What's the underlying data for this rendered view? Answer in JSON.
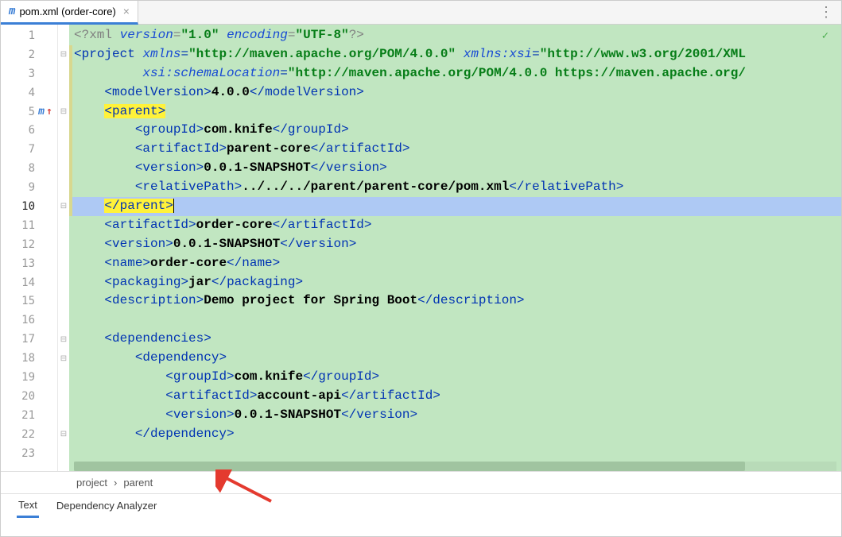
{
  "tab": {
    "icon": "m",
    "label": "pom.xml (order-core)",
    "close": "×"
  },
  "menu_dots": "⋮",
  "gutter": {
    "lines": [
      "1",
      "2",
      "3",
      "4",
      "5",
      "6",
      "7",
      "8",
      "9",
      "10",
      "11",
      "12",
      "13",
      "14",
      "15",
      "16",
      "17",
      "18",
      "19",
      "20",
      "21",
      "22",
      "23"
    ],
    "current": 10,
    "marker_line": 5,
    "marker_m": "m",
    "marker_arrow": "↑"
  },
  "fold": {
    "2": "⊟",
    "5": "⊟",
    "10": "⊟",
    "17": "⊟",
    "18": "⊟",
    "22": "⊟"
  },
  "code": {
    "l1": {
      "pi_open": "<?",
      "pi_name": "xml ",
      "a1": "version",
      "eq": "=",
      "v1": "\"1.0\"",
      "sp": " ",
      "a2": "encoding",
      "v2": "\"UTF-8\"",
      "pi_close": "?>"
    },
    "l2": {
      "open": "<",
      "tag": "project",
      "sp": " ",
      "a1": "xmlns",
      "eq": "=",
      "v1": "\"http://maven.apache.org/POM/4.0.0\"",
      "sp2": " ",
      "a2": "xmlns:xsi",
      "v2": "\"http://www.w3.org/2001/XML"
    },
    "l3": {
      "a1": "xsi:schemaLocation",
      "eq": "=",
      "v1": "\"http://maven.apache.org/POM/4.0.0 https://maven.apache.org/"
    },
    "l4": {
      "o": "<",
      "t": "modelVersion",
      "c": ">",
      "txt": "4.0.0",
      "co": "</",
      "cc": ">"
    },
    "l5": {
      "o": "<",
      "t": "parent",
      "c": ">"
    },
    "l6": {
      "o": "<",
      "t": "groupId",
      "c": ">",
      "txt": "com.knife",
      "co": "</",
      "cc": ">"
    },
    "l7": {
      "o": "<",
      "t": "artifactId",
      "c": ">",
      "txt": "parent-core",
      "co": "</",
      "cc": ">"
    },
    "l8": {
      "o": "<",
      "t": "version",
      "c": ">",
      "txt": "0.0.1-SNAPSHOT",
      "co": "</",
      "cc": ">"
    },
    "l9": {
      "o": "<",
      "t": "relativePath",
      "c": ">",
      "txt": "../../../parent/parent-core/pom.xml",
      "co": "</",
      "cc": ">"
    },
    "l10": {
      "o": "</",
      "t": "parent",
      "c": ">"
    },
    "l11": {
      "o": "<",
      "t": "artifactId",
      "c": ">",
      "txt": "order-core",
      "co": "</",
      "cc": ">"
    },
    "l12": {
      "o": "<",
      "t": "version",
      "c": ">",
      "txt": "0.0.1-SNAPSHOT",
      "co": "</",
      "cc": ">"
    },
    "l13": {
      "o": "<",
      "t": "name",
      "c": ">",
      "txt": "order-core",
      "co": "</",
      "cc": ">"
    },
    "l14": {
      "o": "<",
      "t": "packaging",
      "c": ">",
      "txt": "jar",
      "co": "</",
      "cc": ">"
    },
    "l15": {
      "o": "<",
      "t": "description",
      "c": ">",
      "txt": "Demo project for Spring Boot",
      "co": "</",
      "cc": ">"
    },
    "l17": {
      "o": "<",
      "t": "dependencies",
      "c": ">"
    },
    "l18": {
      "o": "<",
      "t": "dependency",
      "c": ">"
    },
    "l19": {
      "o": "<",
      "t": "groupId",
      "c": ">",
      "txt": "com.knife",
      "co": "</",
      "cc": ">"
    },
    "l20": {
      "o": "<",
      "t": "artifactId",
      "c": ">",
      "txt": "account-api",
      "co": "</",
      "cc": ">"
    },
    "l21": {
      "o": "<",
      "t": "version",
      "c": ">",
      "txt": "0.0.1-SNAPSHOT",
      "co": "</",
      "cc": ">"
    },
    "l22": {
      "o": "</",
      "t": "dependency",
      "c": ">"
    }
  },
  "breadcrumb": {
    "p1": "project",
    "sep": "›",
    "p2": "parent"
  },
  "bottom_tabs": {
    "text": "Text",
    "analyzer": "Dependency Analyzer"
  },
  "check": "✓"
}
